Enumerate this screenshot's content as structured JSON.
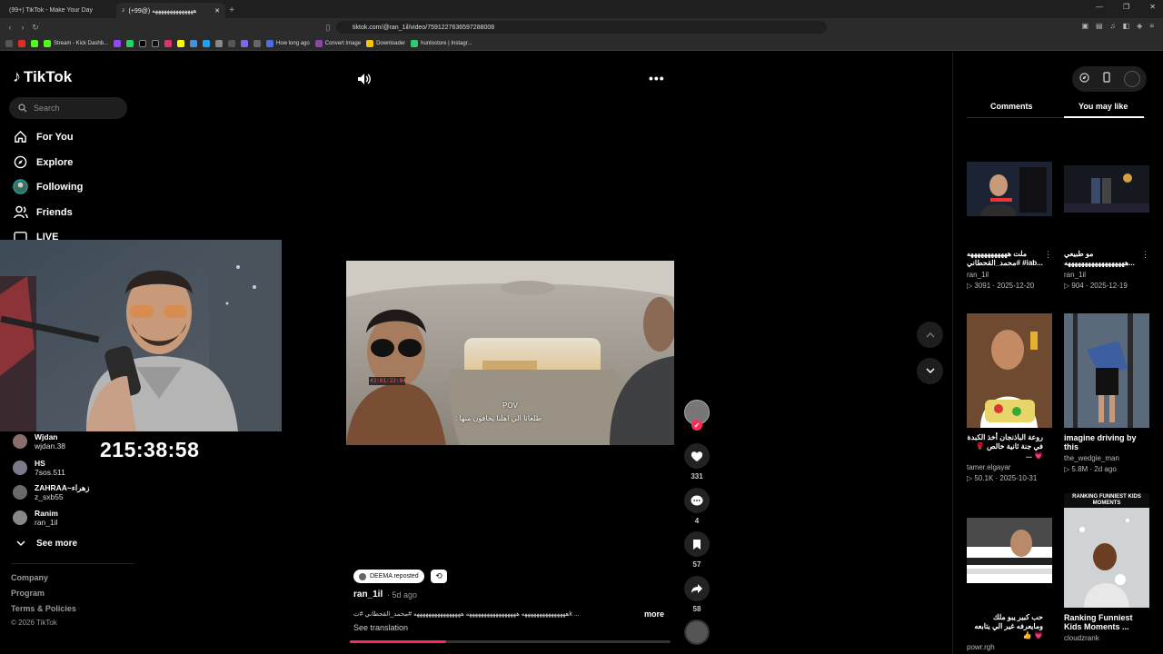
{
  "browser": {
    "tabs": [
      {
        "label": "(99+) TikTok - Make Your Day"
      },
      {
        "label": "ههههههههههههههه (@99+)"
      }
    ],
    "url": "tiktok.com/@ran_1il/video/7591227636597288008",
    "bookmarks": [
      "Stream - Kick Dashb...",
      "How long ago",
      "Convert Image",
      "Downloader",
      "huntostore | Instagr..."
    ]
  },
  "sidebar": {
    "logo": "TikTok",
    "search_placeholder": "Search",
    "nav": [
      {
        "label": "For You",
        "icon": "home-icon"
      },
      {
        "label": "Explore",
        "icon": "compass-icon"
      },
      {
        "label": "Following",
        "icon": "following-avatar-icon"
      },
      {
        "label": "Friends",
        "icon": "friends-icon"
      },
      {
        "label": "LIVE",
        "icon": "live-icon"
      }
    ],
    "following_accounts": [
      {
        "name": "Wjdan",
        "handle": "wjdan.38"
      },
      {
        "name": "HS",
        "handle": "7sos.511"
      },
      {
        "name": "ZAHRAA~زهراء",
        "handle": "z_sxb55"
      },
      {
        "name": "Ranim",
        "handle": "ran_1il"
      }
    ],
    "see_more": "See more",
    "footer": [
      "Company",
      "Program",
      "Terms & Policies"
    ],
    "copyright": "© 2026 TikTok"
  },
  "stream_timer": "215:38:58",
  "video": {
    "pov": "POV",
    "subtitle": "طلعانا الي اهلنا يخافون منها :",
    "timestamp_overlay": "43:01:22:04",
    "progress": 0.3,
    "repost_label": "DEEMA reposted",
    "author": "ran_1il",
    "posted": "5d ago",
    "description": "هههههههههههههههه  هههههههههههههههههه  ههههههههههههههههه  #محمد_القحطاني  #تk ...",
    "more_label": "more",
    "see_translation": "See translation"
  },
  "actions": [
    {
      "name": "like",
      "count": "331"
    },
    {
      "name": "comment",
      "count": "4"
    },
    {
      "name": "bookmark",
      "count": "57"
    },
    {
      "name": "share",
      "count": "58"
    }
  ],
  "right_panel": {
    "tabs": [
      {
        "label": "Comments",
        "active": false
      },
      {
        "label": "You may like",
        "active": true
      }
    ],
    "cards": [
      {
        "title": "ملت ههههههههههههه #محمد_القحطاني #iab...",
        "user": "ran_1il",
        "views": "3091",
        "date": "2025-12-20"
      },
      {
        "title": "مو طبيعي ههههههههههههههههههه...",
        "user": "ran_1il",
        "views": "904",
        "date": "2025-12-19"
      },
      {
        "title": "روعة الباذنجان أخذ الكبدة في جنة ثانية خالص 🌹 💗 ...",
        "user": "tamer.elgayar",
        "views": "50.1K",
        "date": "2025-10-31"
      },
      {
        "title": "imagine driving by this",
        "user": "the_wedgie_man",
        "views": "5.8M",
        "date": "2d ago"
      },
      {
        "title": "حب كبير يبو ملك ومايعرفه غير الي يتابعه 💗 👍",
        "user": "powr.rgh",
        "views": "",
        "date": ""
      },
      {
        "title": "Ranking Funniest Kids Moments ...",
        "user": "cloudzrank",
        "views": "",
        "date": ""
      }
    ],
    "thumb_text": "RANKING FUNNIEST KIDS MOMENTS"
  },
  "colors": {
    "accent": "#fe2c55",
    "bg": "#000000",
    "panel": "#1e1e1e"
  }
}
